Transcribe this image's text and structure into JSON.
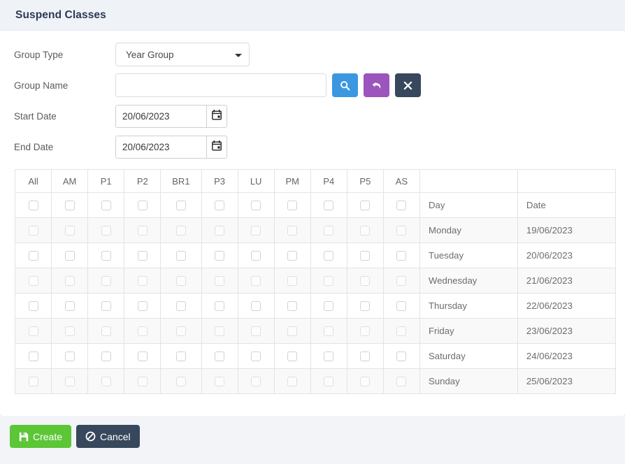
{
  "header": {
    "title": "Suspend Classes"
  },
  "form": {
    "group_type": {
      "label": "Group Type",
      "selected": "Year Group",
      "options": [
        "Year Group"
      ]
    },
    "group_name": {
      "label": "Group Name",
      "value": "",
      "placeholder": ""
    },
    "start_date": {
      "label": "Start Date",
      "value": "20/06/2023"
    },
    "end_date": {
      "label": "End Date",
      "value": "20/06/2023"
    },
    "actions": {
      "search": "search-icon",
      "undo": "undo-arrow-icon",
      "clear": "close-x-icon"
    }
  },
  "table": {
    "columns": [
      "All",
      "AM",
      "P1",
      "P2",
      "BR1",
      "P3",
      "LU",
      "PM",
      "P4",
      "P5",
      "AS",
      "",
      ""
    ],
    "rows": [
      {
        "day": "Day",
        "date": "Date",
        "striped": false
      },
      {
        "day": "Monday",
        "date": "19/06/2023",
        "striped": true
      },
      {
        "day": "Tuesday",
        "date": "20/06/2023",
        "striped": false
      },
      {
        "day": "Wednesday",
        "date": "21/06/2023",
        "striped": true
      },
      {
        "day": "Thursday",
        "date": "22/06/2023",
        "striped": false
      },
      {
        "day": "Friday",
        "date": "23/06/2023",
        "striped": true
      },
      {
        "day": "Saturday",
        "date": "24/06/2023",
        "striped": false
      },
      {
        "day": "Sunday",
        "date": "25/06/2023",
        "striped": true
      }
    ],
    "checkbox_columns": 11,
    "checked": false
  },
  "footer": {
    "create_label": "Create",
    "cancel_label": "Cancel"
  },
  "colors": {
    "header_bg": "#eff2f7",
    "title": "#2b3a52",
    "search_btn": "#3b97e0",
    "undo_btn": "#9b55bd",
    "clear_btn": "#37475c",
    "create_btn": "#5cc636",
    "cancel_btn": "#37475c",
    "page_bg": "#f2f4f7",
    "stripe": "#f9f9f9"
  }
}
